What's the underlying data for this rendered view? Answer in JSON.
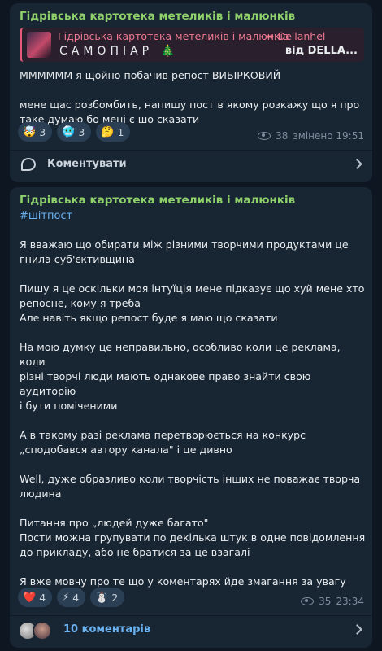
{
  "post1": {
    "channel": "Гідрівська картотека метеликів і малюнків",
    "forward": {
      "title": "Гідрівська картотека метеликів і малюнків",
      "author": "➦ Dellanhel",
      "subtitle": "САМОПІАР 🎄",
      "from": "від DELLA..."
    },
    "paragraphs": [
      "ММММММ я щойно побачив репост ВИБІРКОВИЙ",
      "мене щас розбомбить, напишу пост в якому розкажу що я про\nтаке думаю бо мені є шо сказати"
    ],
    "reactions": [
      {
        "emoji": "🤯",
        "count": "3"
      },
      {
        "emoji": "🥶",
        "count": "3"
      },
      {
        "emoji": "🤔",
        "count": "1"
      }
    ],
    "views": "38",
    "time": "змінено 19:51",
    "comments_label": "Коментувати"
  },
  "post2": {
    "channel": "Гідрівська картотека метеликів і малюнків",
    "hashtag": "#шітпост",
    "paragraphs": [
      "Я вважаю що обирати між різними творчими продуктами це\nгнила суб'єктивщина",
      "Пишу я це оскільки моя інтуїція мене підказує що хуй мене хто\nрепосне, кому я треба\nАле навіть якщо репост буде я маю що сказати",
      "На мою думку це неправильно, особливо коли це реклама, коли\nрізні творчі люди мають однакове право знайти свою аудиторію\nі бути поміченими",
      "А в такому разі реклама перетворюється на конкурс\n„сподобався автору канала\" і це дивно",
      "Well, дуже образливо коли творчість інших не поважає творча\nлюдина",
      "",
      "Питання про „людей дуже багато\"\nПости можна групувати по декілька штук в одне повідомлення\nдо прикладу, або не братися за це взагалі",
      "Я вже мовчу про те що у коментарях йде змагання за увагу"
    ],
    "reactions": [
      {
        "emoji": "❤️",
        "count": "4"
      },
      {
        "emoji": "⚡",
        "count": "4"
      },
      {
        "emoji": "☃️",
        "count": "2"
      }
    ],
    "views": "35",
    "time": "23:34",
    "comments_label": "10 коментарів"
  }
}
